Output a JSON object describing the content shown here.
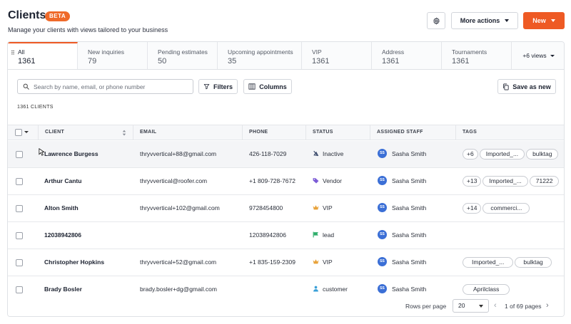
{
  "header": {
    "title": "Clients",
    "badge": "BETA",
    "subtitle": "Manage your clients with views tailored to your business",
    "more_actions_label": "More actions",
    "new_label": "New"
  },
  "tabs": [
    {
      "label": "All",
      "count": "1361",
      "active": true
    },
    {
      "label": "New inquiries",
      "count": "79"
    },
    {
      "label": "Pending estimates",
      "count": "50"
    },
    {
      "label": "Upcoming appointments",
      "count": "35"
    },
    {
      "label": "VIP",
      "count": "1361"
    },
    {
      "label": "Address",
      "count": "1361"
    },
    {
      "label": "Tournaments",
      "count": "1361"
    }
  ],
  "more_views_label": "+6 views",
  "toolbar": {
    "search_placeholder": "Search by name, email, or phone number",
    "filters_label": "Filters",
    "columns_label": "Columns",
    "save_as_new_label": "Save as new"
  },
  "count_label": "1361 CLIENTS",
  "columns": {
    "client": "CLIENT",
    "email": "EMAIL",
    "phone": "PHONE",
    "status": "STATUS",
    "assigned_staff": "ASSIGNED STAFF",
    "tags": "TAGS"
  },
  "rows": [
    {
      "client": "Lawrence Burgess",
      "email": "thryvvertical+88@gmail.com",
      "phone": "426-118-7029",
      "status": "Inactive",
      "status_icon": "inactive-icon",
      "staff_initials": "SS",
      "staff": "Sasha Smith",
      "tags": [
        "+6",
        "Imported_...",
        "bulktag"
      ]
    },
    {
      "client": "Arthur Cantu",
      "email": "thryvvertical@roofer.com",
      "phone": "+1 809-728-7672",
      "status": "Vendor",
      "status_icon": "tag-icon",
      "staff_initials": "SS",
      "staff": "Sasha Smith",
      "tags": [
        "+13",
        "Imported_...",
        "71222"
      ]
    },
    {
      "client": "Alton Smith",
      "email": "thryvvertical+102@gmail.com",
      "phone": "9728454800",
      "status": "VIP",
      "status_icon": "crown-icon",
      "staff_initials": "SS",
      "staff": "Sasha Smith",
      "tags": [
        "+14",
        "commerci..."
      ]
    },
    {
      "client": "12038942806",
      "email": "",
      "phone": "12038942806",
      "status": "lead",
      "status_icon": "flag-icon",
      "staff_initials": "SS",
      "staff": "Sasha Smith",
      "tags": []
    },
    {
      "client": "Christopher Hopkins",
      "email": "thryvvertical+52@gmail.com",
      "phone": "+1 835-159-2309",
      "status": "VIP",
      "status_icon": "crown-icon",
      "staff_initials": "SS",
      "staff": "Sasha Smith",
      "tags": [
        "Imported_...",
        "bulktag"
      ]
    },
    {
      "client": "Brady Bosler",
      "email": "brady.bosler+dg@gmail.com",
      "phone": "",
      "status": "customer",
      "status_icon": "person-icon",
      "staff_initials": "SS",
      "staff": "Sasha Smith",
      "tags": [
        "Aprilclass"
      ]
    }
  ],
  "footer": {
    "rows_per_page_label": "Rows per page",
    "rows_per_page_value": "20",
    "pages_text": "1 of 69 pages"
  },
  "colors": {
    "accent": "#ee5a24",
    "avatar": "#3b6fd6",
    "vendor": "#7b5bd6",
    "vip": "#e8a23a",
    "lead": "#2fae6b",
    "customer": "#3aa0d8",
    "inactive": "#3a4a6b"
  }
}
